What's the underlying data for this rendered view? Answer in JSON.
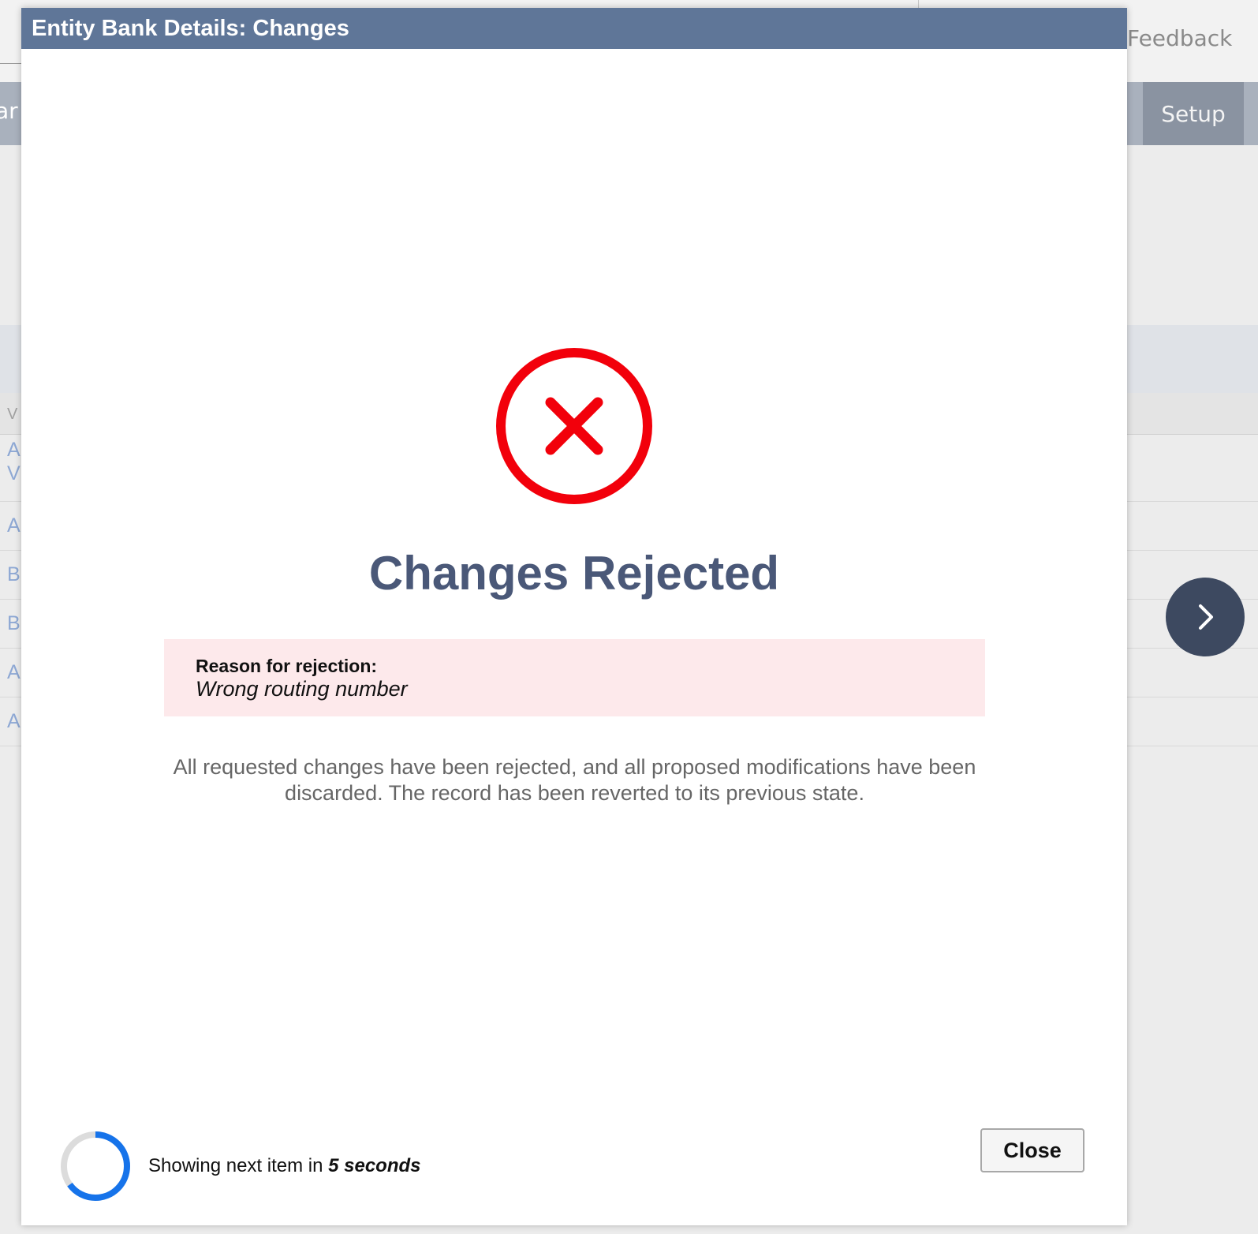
{
  "background": {
    "feedback_label": "Feedback",
    "nav_left_label": "ar",
    "setup_label": "Setup",
    "column_header_fragment": "V",
    "row_fragments": [
      "A\nV",
      "A",
      "B",
      "B",
      "A",
      "A"
    ]
  },
  "modal": {
    "title": "Entity Bank Details: Changes",
    "heading": "Changes Rejected",
    "reason_label": "Reason for rejection:",
    "reason_value": "Wrong routing number",
    "message": "All requested changes have been rejected, and all proposed modifications have been discarded. The record has been reverted to its previous state.",
    "countdown_prefix": "Showing next item in",
    "countdown_value": "5 seconds",
    "countdown_progress": 0.65,
    "close_label": "Close"
  },
  "colors": {
    "header": "#5f7698",
    "error_red": "#f2000b",
    "heading_text": "#4a5878",
    "reason_bg": "#fde9eb",
    "ring_progress": "#1673ea",
    "ring_track": "#dcdcdc"
  },
  "icons": {
    "error": "x-circle-icon",
    "next": "chevron-right-icon"
  }
}
